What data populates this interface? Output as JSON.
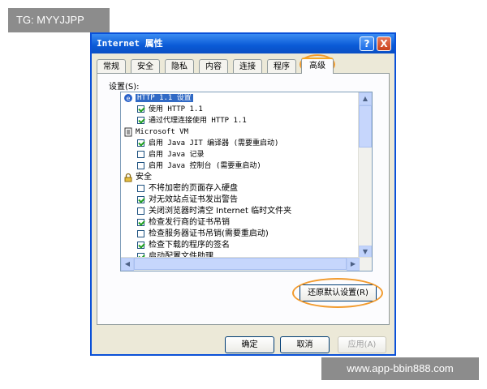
{
  "watermarks": {
    "top_left": "TG: MYYJJPP",
    "bottom_right": "www.app-bbin888.com"
  },
  "window": {
    "title": "Internet 属性",
    "help_glyph": "?",
    "close_glyph": "X",
    "tabs": [
      "常规",
      "安全",
      "隐私",
      "内容",
      "连接",
      "程序",
      "高级"
    ],
    "active_tab": "高级",
    "settings_label": "设置(S):",
    "restore_defaults_label": "还原默认设置(R)",
    "ok_label": "确定",
    "cancel_label": "取消",
    "apply_label": "应用(A)",
    "list": {
      "items": [
        {
          "type": "category",
          "icon": "ie-icon",
          "text": "HTTP 1.1 设置",
          "selected": true
        },
        {
          "type": "checkbox",
          "checked": true,
          "text": "使用 HTTP 1.1"
        },
        {
          "type": "checkbox",
          "checked": true,
          "text": "通过代理连接使用 HTTP 1.1"
        },
        {
          "type": "category",
          "icon": "document-icon",
          "text": "Microsoft VM"
        },
        {
          "type": "checkbox",
          "checked": true,
          "text": "启用 Java JIT 编译器 (需要重启动)"
        },
        {
          "type": "checkbox",
          "checked": false,
          "text": "启用 Java 记录"
        },
        {
          "type": "checkbox",
          "checked": false,
          "text": "启用 Java 控制台 (需要重启动)"
        },
        {
          "type": "category",
          "icon": "lock-icon",
          "text": "安全"
        },
        {
          "type": "checkbox",
          "checked": false,
          "text": "不将加密的页面存入硬盘"
        },
        {
          "type": "checkbox",
          "checked": true,
          "text": "对无效站点证书发出警告"
        },
        {
          "type": "checkbox",
          "checked": false,
          "text": "关闭浏览器时清空 Internet 临时文件夹"
        },
        {
          "type": "checkbox",
          "checked": true,
          "text": "检查发行商的证书吊销"
        },
        {
          "type": "checkbox",
          "checked": false,
          "text": "检查服务器证书吊销(需要重启动)"
        },
        {
          "type": "checkbox",
          "checked": true,
          "text": "检查下载的程序的签名"
        },
        {
          "type": "checkbox",
          "checked": true,
          "text": "启动配置文件助理"
        }
      ]
    }
  },
  "colors": {
    "titlebar": "#0a5ad6",
    "highlight": "#f29b2e",
    "selection": "#316ac5"
  }
}
